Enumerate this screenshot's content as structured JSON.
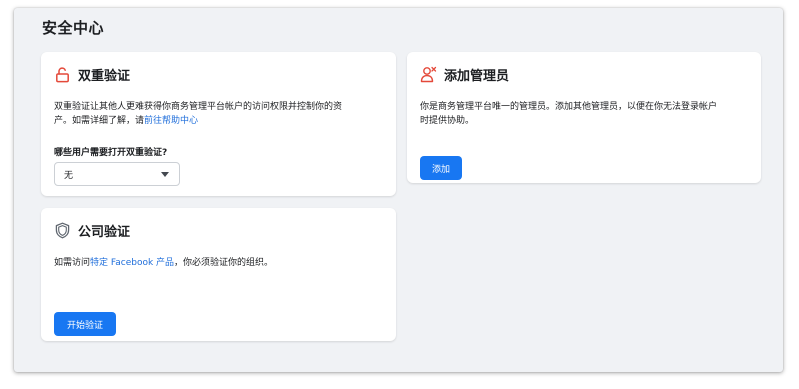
{
  "page": {
    "title": "安全中心"
  },
  "two_factor": {
    "title": "双重验证",
    "description_line1": "双重验证让其他人更难获得你商务管理平台帐户的访问权限并控制你的资",
    "description_line2_prefix": "产。如需详细了解，请",
    "description_link": "前往帮助中心",
    "question": "哪些用户需要打开双重验证?",
    "select_value": "无",
    "icon": "unlock-icon",
    "accent": "#e4493a"
  },
  "admin": {
    "title": "添加管理员",
    "description_line1": "你是商务管理平台唯一的管理员。添加其他管理员，以便在你无法登录帐户",
    "description_line2": "时提供协助。",
    "button_label": "添加",
    "icon": "person-remove-icon",
    "accent": "#e4493a"
  },
  "company": {
    "title": "公司验证",
    "description_prefix": "如需访问",
    "description_link": "特定 Facebook 产品",
    "description_suffix": "，你必须验证你的组织。",
    "button_label": "开始验证",
    "icon": "shield-icon"
  },
  "colors": {
    "primary_button": "#1877f2",
    "link": "#216fdb",
    "background": "#f0f2f5",
    "card": "#ffffff"
  }
}
